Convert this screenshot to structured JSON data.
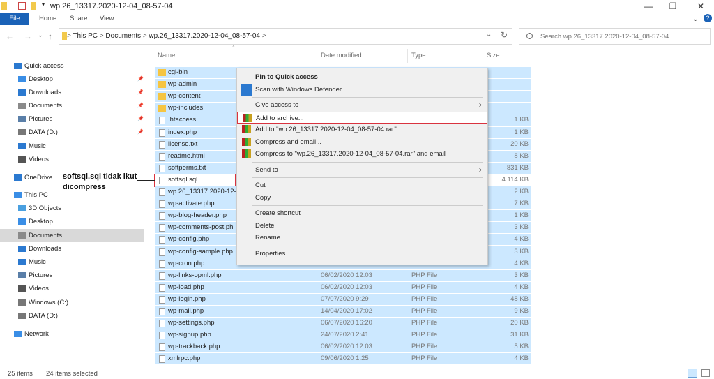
{
  "window": {
    "title": "wp.26_13317.2020-12-04_08-57-04",
    "minimize": "—",
    "maximize": "❐",
    "close": "✕",
    "help": "?",
    "expand": "⌄"
  },
  "ribbon": {
    "tabs": [
      "File",
      "Home",
      "Share",
      "View"
    ]
  },
  "nav": {
    "back": "←",
    "forward": "→",
    "recent": "⌄",
    "up": "↑",
    "refresh": "↻",
    "addr_dropdown": "⌄",
    "breadcrumb": [
      "This PC",
      "Documents",
      "wp.26_13317.2020-12-04_08-57-04"
    ],
    "sep": ">"
  },
  "search": {
    "placeholder": "Search wp.26_13317.2020-12-04_08-57-04"
  },
  "columns": {
    "name": "Name",
    "date": "Date modified",
    "type": "Type",
    "size": "Size"
  },
  "sidebar": [
    {
      "label": "Quick access",
      "icon": "star-icon",
      "top": true
    },
    {
      "label": "Desktop",
      "icon": "desktop-icon",
      "pin": true
    },
    {
      "label": "Downloads",
      "icon": "download-icon",
      "pin": true
    },
    {
      "label": "Documents",
      "icon": "documents-icon",
      "pin": true
    },
    {
      "label": "Pictures",
      "icon": "pictures-icon",
      "pin": true
    },
    {
      "label": "DATA (D:)",
      "icon": "drive-icon",
      "pin": true
    },
    {
      "label": "Music",
      "icon": "music-icon"
    },
    {
      "label": "Videos",
      "icon": "videos-icon"
    },
    {
      "label": "OneDrive",
      "icon": "cloud-icon",
      "top": true
    },
    {
      "label": "This PC",
      "icon": "computer-icon",
      "top": true
    },
    {
      "label": "3D Objects",
      "icon": "3d-objects-icon"
    },
    {
      "label": "Desktop",
      "icon": "desktop-icon"
    },
    {
      "label": "Documents",
      "icon": "documents-icon",
      "selected": true
    },
    {
      "label": "Downloads",
      "icon": "download-icon"
    },
    {
      "label": "Music",
      "icon": "music-icon"
    },
    {
      "label": "Pictures",
      "icon": "pictures-icon"
    },
    {
      "label": "Videos",
      "icon": "videos-icon"
    },
    {
      "label": "Windows (C:)",
      "icon": "drive-icon"
    },
    {
      "label": "DATA (D:)",
      "icon": "drive-icon"
    },
    {
      "label": "Network",
      "icon": "network-icon",
      "top": true
    }
  ],
  "files": [
    {
      "name": "cgi-bin",
      "folder": true
    },
    {
      "name": "wp-admin",
      "folder": true
    },
    {
      "name": "wp-content",
      "folder": true
    },
    {
      "name": "wp-includes",
      "folder": true
    },
    {
      "name": ".htaccess",
      "size": "1 KB"
    },
    {
      "name": "index.php",
      "size": "1 KB"
    },
    {
      "name": "license.txt",
      "size": "20 KB"
    },
    {
      "name": "readme.html",
      "size": "8 KB"
    },
    {
      "name": "softperms.txt",
      "size": "831 KB"
    },
    {
      "name": "softsql.sql",
      "size": "4.114 KB",
      "unselected": true
    },
    {
      "name": "wp.26_13317.2020-12-",
      "size": "2 KB"
    },
    {
      "name": "wp-activate.php",
      "size": "7 KB"
    },
    {
      "name": "wp-blog-header.php",
      "size": "1 KB"
    },
    {
      "name": "wp-comments-post.ph",
      "size": "3 KB"
    },
    {
      "name": "wp-config.php",
      "size": "4 KB"
    },
    {
      "name": "wp-config-sample.php",
      "size": "3 KB"
    },
    {
      "name": "wp-cron.php",
      "size": "4 KB"
    },
    {
      "name": "wp-links-opml.php",
      "date": "06/02/2020 12:03",
      "type": "PHP File",
      "size": "3 KB"
    },
    {
      "name": "wp-load.php",
      "date": "06/02/2020 12:03",
      "type": "PHP File",
      "size": "4 KB"
    },
    {
      "name": "wp-login.php",
      "date": "07/07/2020 9:29",
      "type": "PHP File",
      "size": "48 KB"
    },
    {
      "name": "wp-mail.php",
      "date": "14/04/2020 17:02",
      "type": "PHP File",
      "size": "9 KB"
    },
    {
      "name": "wp-settings.php",
      "date": "06/07/2020 16:20",
      "type": "PHP File",
      "size": "20 KB"
    },
    {
      "name": "wp-signup.php",
      "date": "24/07/2020 2:41",
      "type": "PHP File",
      "size": "31 KB"
    },
    {
      "name": "wp-trackback.php",
      "date": "06/02/2020 12:03",
      "type": "PHP File",
      "size": "5 KB"
    },
    {
      "name": "xmlrpc.php",
      "date": "09/06/2020 1:25",
      "type": "PHP File",
      "size": "4 KB"
    }
  ],
  "context_menu": [
    {
      "label": "Pin to Quick access",
      "bold": true
    },
    {
      "label": "Scan with Windows Defender...",
      "icon": "defender-icon"
    },
    {
      "sep": true
    },
    {
      "label": "Give access to",
      "submenu": true
    },
    {
      "label": "Add to archive...",
      "icon": "winrar-icon",
      "highlight": true
    },
    {
      "label": "Add to \"wp.26_13317.2020-12-04_08-57-04.rar\"",
      "icon": "winrar-icon"
    },
    {
      "label": "Compress and email...",
      "icon": "winrar-icon"
    },
    {
      "label": "Compress to \"wp.26_13317.2020-12-04_08-57-04.rar\" and email",
      "icon": "winrar-icon"
    },
    {
      "sep": true
    },
    {
      "label": "Send to",
      "submenu": true
    },
    {
      "sep": true
    },
    {
      "label": "Cut"
    },
    {
      "label": "Copy"
    },
    {
      "sep": true
    },
    {
      "label": "Create shortcut"
    },
    {
      "label": "Delete"
    },
    {
      "label": "Rename"
    },
    {
      "sep": true
    },
    {
      "label": "Properties"
    }
  ],
  "annotation": {
    "line1": "softsql.sql tidak ikut",
    "line2": "dicompress",
    "color": "#d9333f"
  },
  "status": {
    "items": "25 items",
    "selected": "24 items selected"
  }
}
